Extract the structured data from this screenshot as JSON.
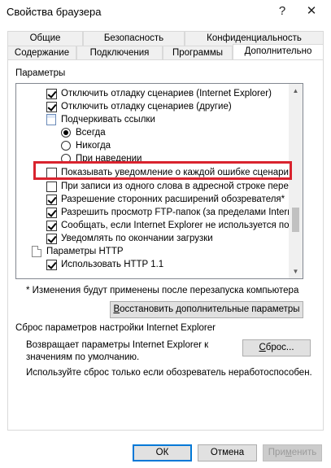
{
  "window": {
    "title": "Свойства браузера",
    "help_glyph": "?",
    "close_glyph": "✕"
  },
  "tabs_row1": [
    "Общие",
    "Безопасность",
    "Конфиденциальность"
  ],
  "tabs_row2": [
    "Содержание",
    "Подключения",
    "Программы",
    "Дополнительно"
  ],
  "active_tab": "Дополнительно",
  "settings_group_label": "Параметры",
  "settings_list": [
    {
      "type": "checkbox",
      "checked": true,
      "label": "Отключить отладку сценариев (Internet Explorer)"
    },
    {
      "type": "checkbox",
      "checked": true,
      "label": "Отключить отладку сценариев (другие)"
    },
    {
      "type": "group",
      "icon": "links-icon",
      "label": "Подчеркивать ссылки"
    },
    {
      "type": "radio",
      "selected": true,
      "label": "Всегда"
    },
    {
      "type": "radio",
      "selected": false,
      "label": "Никогда"
    },
    {
      "type": "radio",
      "selected": false,
      "label": "При наведении"
    },
    {
      "type": "checkbox",
      "checked": false,
      "label": "Показывать уведомление о каждой ошибке сценария"
    },
    {
      "type": "checkbox",
      "checked": false,
      "label": "При записи из одного слова в адресной строке перехо..."
    },
    {
      "type": "checkbox",
      "checked": true,
      "label": "Разрешение сторонних расширений обозревателя*"
    },
    {
      "type": "checkbox",
      "checked": true,
      "label": "Разрешить просмотр FTP-папок (за пределами Internet"
    },
    {
      "type": "checkbox",
      "checked": true,
      "label": "Сообщать, если Internet Explorer не используется по у"
    },
    {
      "type": "checkbox",
      "checked": true,
      "label": "Уведомлять по окончании загрузки"
    },
    {
      "type": "group",
      "icon": "page-icon",
      "label": "Параметры HTTP"
    },
    {
      "type": "checkbox",
      "checked": true,
      "label": "Использовать HTTP 1.1"
    }
  ],
  "restart_note": "* Изменения будут применены после перезапуска компьютера",
  "restore_button": {
    "prefix": "",
    "underlined": "В",
    "rest": "осстановить дополнительные параметры"
  },
  "reset_section_label": "Сброс параметров настройки Internet Explorer",
  "reset_description": "Возвращает параметры Internet Explorer к значениям по умолчанию.",
  "reset_button": {
    "underlined": "С",
    "rest": "брос..."
  },
  "reset_warning": "Используйте сброс только если обозреватель неработоспособен.",
  "footer": {
    "ok": "ОК",
    "cancel": "Отмена",
    "apply": {
      "prefix": "При",
      "underlined": "м",
      "rest": "енить"
    }
  },
  "colors": {
    "highlight_box": "#d9232e",
    "default_button_border": "#0078d7"
  }
}
